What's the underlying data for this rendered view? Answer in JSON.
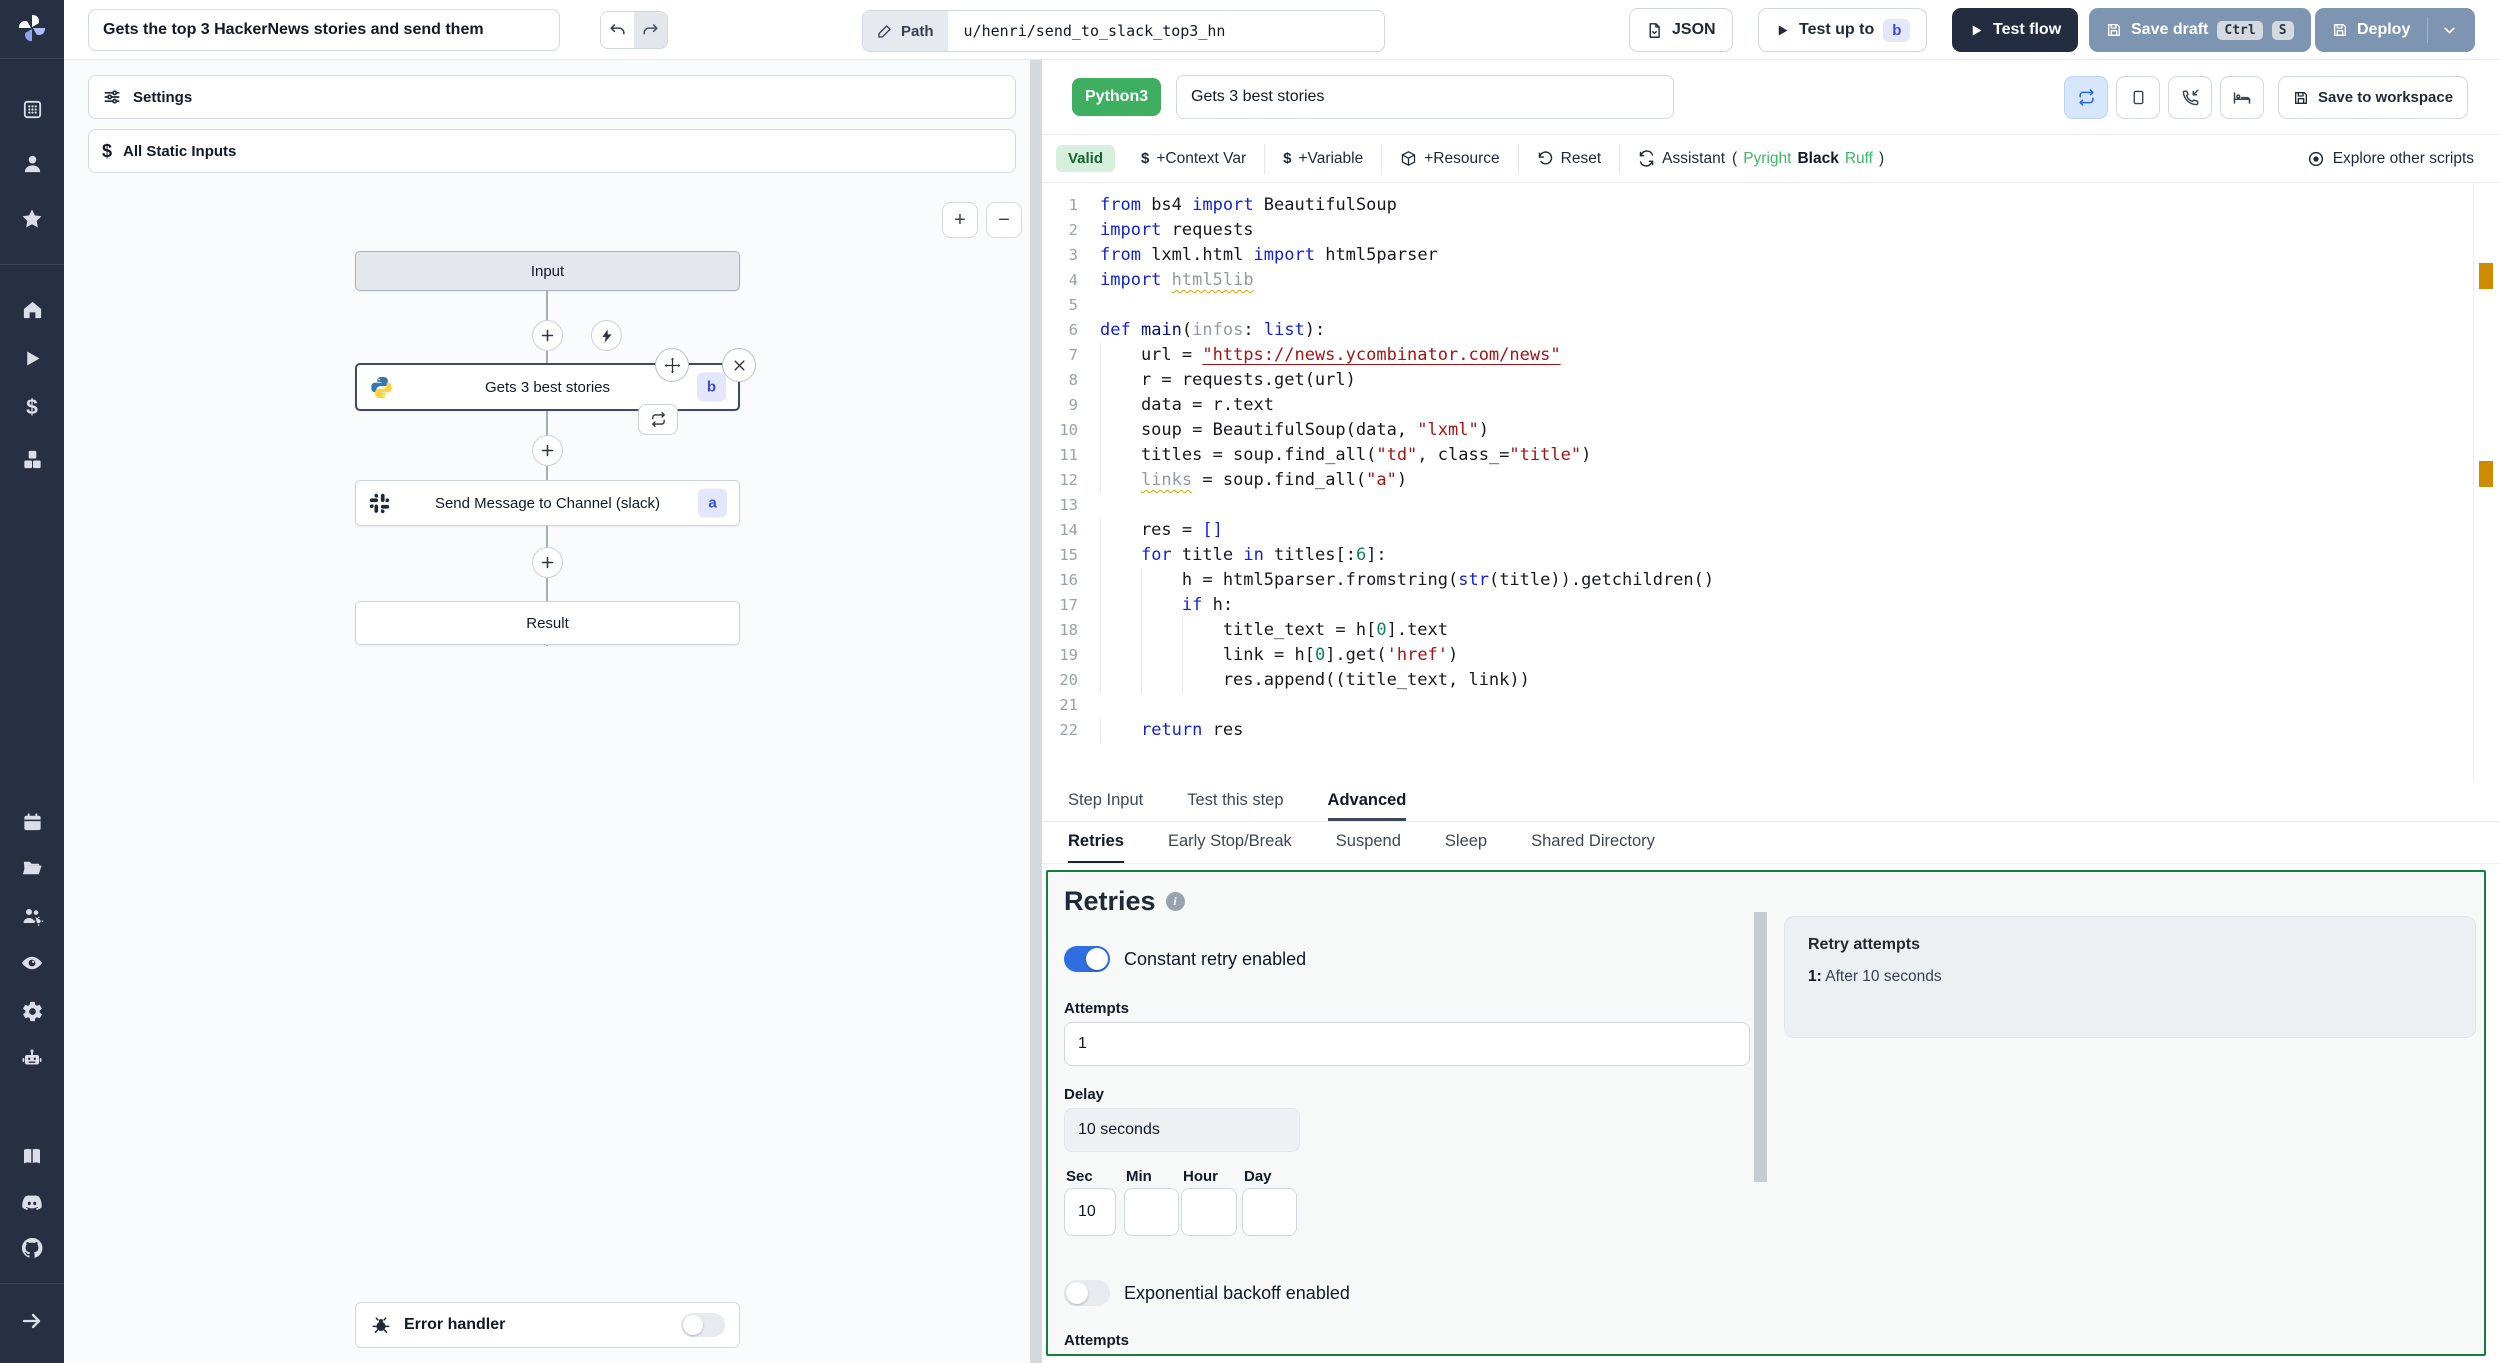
{
  "icons": {
    "dollar": "$",
    "plus": "+",
    "minus": "−",
    "info": "i"
  },
  "topbar": {
    "title_value": "Gets the top 3 HackerNews stories and send them",
    "path_label": "Path",
    "path_value": "u/henri/send_to_slack_top3_hn",
    "json_label": "JSON",
    "test_up_to_label": "Test up to",
    "test_up_to_badge": "b",
    "test_flow_label": "Test flow",
    "save_draft_label": "Save draft",
    "ctrl_key": "Ctrl",
    "s_key": "S",
    "deploy_label": "Deploy"
  },
  "flow": {
    "settings_label": "Settings",
    "static_inputs_label": "All Static Inputs",
    "nodes": {
      "input": {
        "label": "Input"
      },
      "step_b": {
        "label": "Gets 3 best stories",
        "badge": "b"
      },
      "step_a": {
        "label": "Send Message to Channel (slack)",
        "badge": "a"
      },
      "result": {
        "label": "Result"
      }
    },
    "error_handler_label": "Error handler"
  },
  "editor": {
    "lang_badge": "Python3",
    "summary_value": "Gets 3 best stories",
    "save_to_workspace_label": "Save to workspace",
    "toolbar": {
      "valid": "Valid",
      "context_var": "+Context Var",
      "variable": "+Variable",
      "resource": "+Resource",
      "reset": "Reset",
      "assistant": "Assistant",
      "paren_open": "(",
      "pyright": "Pyright",
      "black": "Black",
      "ruff": "Ruff",
      "paren_close": ")",
      "explore": "Explore other scripts"
    },
    "tabs": {
      "step_input": "Step Input",
      "test_step": "Test this step",
      "advanced": "Advanced"
    },
    "subtabs": [
      "Retries",
      "Early Stop/Break",
      "Suspend",
      "Sleep",
      "Shared Directory"
    ],
    "code": {
      "lines": [
        [
          [
            "k",
            "from"
          ],
          [
            "n",
            " bs4 "
          ],
          [
            "k",
            "import"
          ],
          [
            "n",
            " BeautifulSoup"
          ]
        ],
        [
          [
            "k",
            "import"
          ],
          [
            "n",
            " requests"
          ]
        ],
        [
          [
            "k",
            "from"
          ],
          [
            "n",
            " lxml.html "
          ],
          [
            "k",
            "import"
          ],
          [
            "n",
            " html5parser"
          ]
        ],
        [
          [
            "k",
            "import"
          ],
          [
            "n",
            " "
          ],
          [
            "w",
            "html5lib"
          ]
        ],
        [],
        [
          [
            "k",
            "def"
          ],
          [
            "n",
            " "
          ],
          [
            "v",
            "main"
          ],
          [
            "n",
            "("
          ],
          [
            "d",
            "infos"
          ],
          [
            "n",
            ": "
          ],
          [
            "k",
            "list"
          ],
          [
            "n",
            "):"
          ]
        ],
        [
          [
            "n",
            "    url = "
          ],
          [
            "u",
            "\"https://news.ycombinator.com/news\""
          ]
        ],
        [
          [
            "n",
            "    r = requests.get(url)"
          ]
        ],
        [
          [
            "n",
            "    data = r.text"
          ]
        ],
        [
          [
            "n",
            "    soup = BeautifulSoup(data, "
          ],
          [
            "s",
            "\"lxml\""
          ],
          [
            "n",
            ")"
          ]
        ],
        [
          [
            "n",
            "    titles = soup.find_all("
          ],
          [
            "s",
            "\"td\""
          ],
          [
            "n",
            ", class_="
          ],
          [
            "s",
            "\"title\""
          ],
          [
            "n",
            ")"
          ]
        ],
        [
          [
            "n",
            "    "
          ],
          [
            "w",
            "links"
          ],
          [
            "n",
            " = soup.find_all("
          ],
          [
            "s",
            "\"a\""
          ],
          [
            "n",
            ")"
          ]
        ],
        [],
        [
          [
            "n",
            "    res = "
          ],
          [
            "k",
            "[]"
          ]
        ],
        [
          [
            "n",
            "    "
          ],
          [
            "k",
            "for"
          ],
          [
            "n",
            " title "
          ],
          [
            "k",
            "in"
          ],
          [
            "n",
            " titles[:"
          ],
          [
            "g",
            "6"
          ],
          [
            "n",
            "]:"
          ]
        ],
        [
          [
            "n",
            "        h = html5parser.fromstring("
          ],
          [
            "k",
            "str"
          ],
          [
            "n",
            "(title)).getchildren()"
          ]
        ],
        [
          [
            "n",
            "        "
          ],
          [
            "k",
            "if"
          ],
          [
            "n",
            " h:"
          ]
        ],
        [
          [
            "n",
            "            title_text = h["
          ],
          [
            "g",
            "0"
          ],
          [
            "n",
            "].text"
          ]
        ],
        [
          [
            "n",
            "            link = h["
          ],
          [
            "g",
            "0"
          ],
          [
            "n",
            "].get("
          ],
          [
            "s",
            "'href'"
          ],
          [
            "n",
            ")"
          ]
        ],
        [
          [
            "n",
            "            res.append((title_text, link))"
          ]
        ],
        [],
        [
          [
            "n",
            "    "
          ],
          [
            "k",
            "return"
          ],
          [
            "n",
            " res"
          ]
        ]
      ]
    }
  },
  "retries": {
    "heading": "Retries",
    "constant_toggle_label": "Constant retry enabled",
    "attempts_label": "Attempts",
    "attempts_value": "1",
    "delay_label": "Delay",
    "delay_value": "10 seconds",
    "sec_label": "Sec",
    "min_label": "Min",
    "hour_label": "Hour",
    "day_label": "Day",
    "sec_value": "10",
    "backoff_toggle_label": "Exponential backoff enabled",
    "backoff_attempts_label": "Attempts",
    "summary_title": "Retry attempts",
    "summary_item_index": "1:",
    "summary_item_text": "After 10 seconds"
  }
}
